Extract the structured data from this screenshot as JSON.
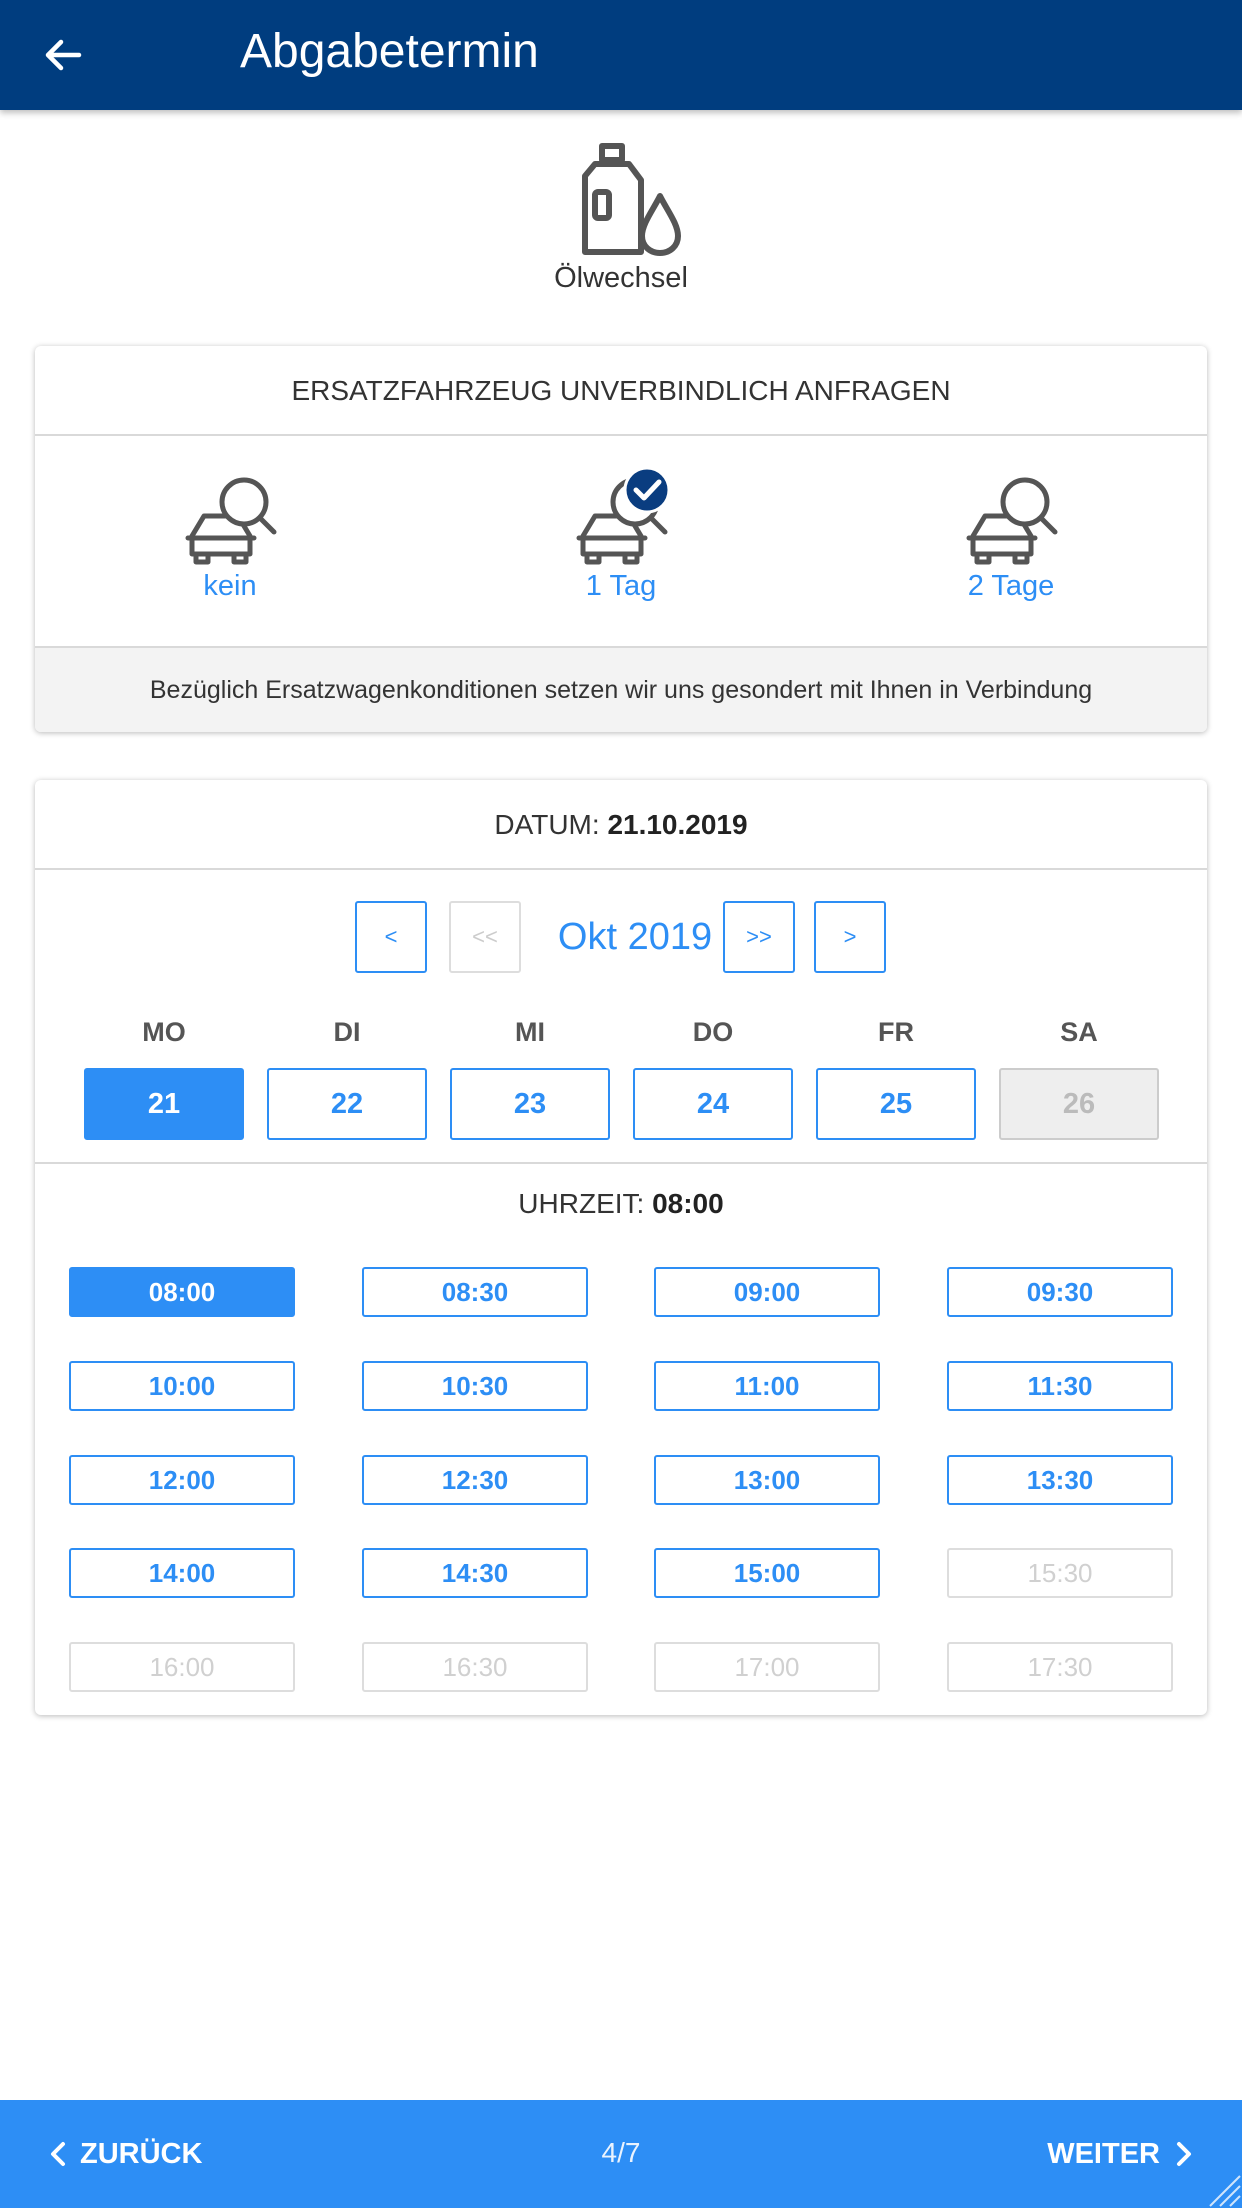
{
  "header": {
    "title": "Abgabetermin",
    "back_icon": "arrow-left-icon"
  },
  "service": {
    "label": "Ölwechsel",
    "icon": "oil-canister-icon"
  },
  "replacement": {
    "title": "ERSATZFAHRZEUG UNVERBINDLICH ANFRAGEN",
    "options": [
      {
        "label": "kein",
        "selected": false
      },
      {
        "label": "1 Tag",
        "selected": true
      },
      {
        "label": "2 Tage",
        "selected": false
      }
    ],
    "note": "Bezüglich Ersatzwagenkonditionen setzen wir uns gesondert mit Ihnen in Verbindung"
  },
  "date": {
    "label": "DATUM:",
    "value": "21.10.2019",
    "nav": {
      "prev": "<",
      "prev_year": "<<",
      "month": "Okt 2019",
      "next_year": ">>",
      "next": ">"
    },
    "weekdays": [
      "MO",
      "DI",
      "MI",
      "DO",
      "FR",
      "SA"
    ],
    "days": [
      {
        "day": "21",
        "state": "selected"
      },
      {
        "day": "22",
        "state": "available"
      },
      {
        "day": "23",
        "state": "available"
      },
      {
        "day": "24",
        "state": "available"
      },
      {
        "day": "25",
        "state": "available"
      },
      {
        "day": "26",
        "state": "disabled"
      }
    ]
  },
  "time": {
    "label": "UHRZEIT:",
    "value": "08:00",
    "slots": [
      {
        "time": "08:00",
        "state": "selected"
      },
      {
        "time": "08:30",
        "state": "available"
      },
      {
        "time": "09:00",
        "state": "available"
      },
      {
        "time": "09:30",
        "state": "available"
      },
      {
        "time": "10:00",
        "state": "available"
      },
      {
        "time": "10:30",
        "state": "available"
      },
      {
        "time": "11:00",
        "state": "available"
      },
      {
        "time": "11:30",
        "state": "available"
      },
      {
        "time": "12:00",
        "state": "available"
      },
      {
        "time": "12:30",
        "state": "available"
      },
      {
        "time": "13:00",
        "state": "available"
      },
      {
        "time": "13:30",
        "state": "available"
      },
      {
        "time": "14:00",
        "state": "available"
      },
      {
        "time": "14:30",
        "state": "available"
      },
      {
        "time": "15:00",
        "state": "available"
      },
      {
        "time": "15:30",
        "state": "disabled"
      },
      {
        "time": "16:00",
        "state": "disabled"
      },
      {
        "time": "16:30",
        "state": "disabled"
      },
      {
        "time": "17:00",
        "state": "disabled"
      },
      {
        "time": "17:30",
        "state": "disabled"
      }
    ]
  },
  "footer": {
    "back": "ZURÜCK",
    "step": "4/7",
    "next": "WEITER"
  },
  "colors": {
    "header": "#003d7f",
    "accent": "#2d8ef5",
    "check_badge": "#0a3d80"
  }
}
